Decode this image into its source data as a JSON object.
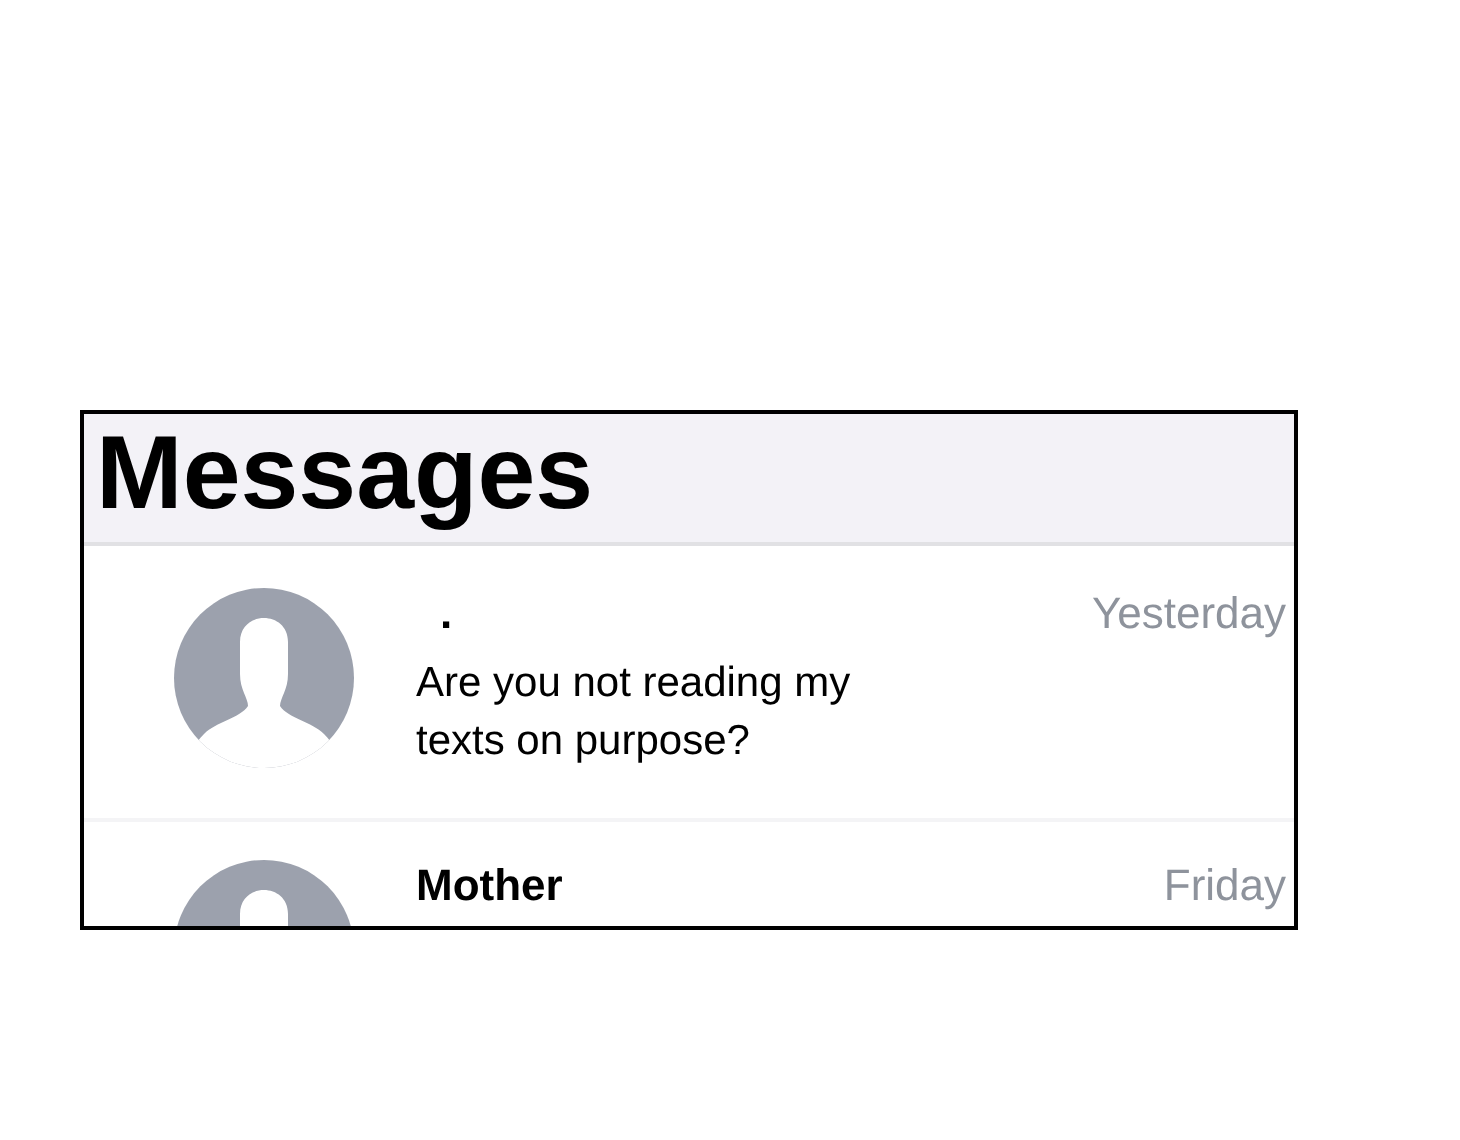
{
  "header": {
    "title": "Messages"
  },
  "conversations": [
    {
      "name": ".",
      "time": "Yesterday",
      "message": "Are you not reading my texts on purpose?"
    },
    {
      "name": "Mother",
      "time": "Friday"
    }
  ]
}
